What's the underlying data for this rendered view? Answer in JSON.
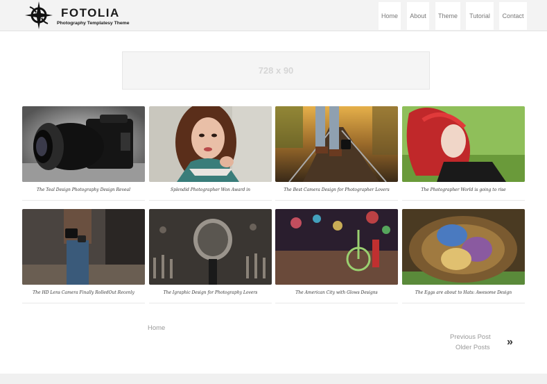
{
  "header": {
    "logo_title": "FOTOLIA",
    "logo_subtitle": "Photography Templatesy Theme",
    "logo_icon": "compass-star-icon",
    "nav": [
      {
        "label": "Home"
      },
      {
        "label": "About"
      },
      {
        "label": "Theme"
      },
      {
        "label": "Tutorial"
      },
      {
        "label": "Contact"
      }
    ]
  },
  "ad": {
    "label": "728 x 90"
  },
  "posts": [
    {
      "caption": "The Teal Design Photography Design Reveal",
      "image": "camera-lens-photo"
    },
    {
      "caption": "Splendid Photographer Won Award in",
      "image": "woman-portrait-photo"
    },
    {
      "caption": "The Best Camera Design for Photographer Lovers",
      "image": "railroad-camera-photo"
    },
    {
      "caption": "The Photographer World is going to rise",
      "image": "red-hair-woman-photo"
    },
    {
      "caption": "The HD Lens Camera Finally RolledOut Recenly",
      "image": "photographer-street-photo"
    },
    {
      "caption": "The Igraphic Design for Photography Lovers",
      "image": "microphone-mixer-photo"
    },
    {
      "caption": "The American City with Glows Designs",
      "image": "bicycle-city-night-photo"
    },
    {
      "caption": "The Eggs are about to Hats: Awesome Design",
      "image": "easter-eggs-nest-photo"
    }
  ],
  "pagination": {
    "home": "Home",
    "previous": "Previous Post",
    "older": "Older Posts",
    "next_icon": "»"
  },
  "colors": {
    "header_bg": "#f3f3f3",
    "text": "#777777",
    "accent": "#1a1a1a"
  }
}
